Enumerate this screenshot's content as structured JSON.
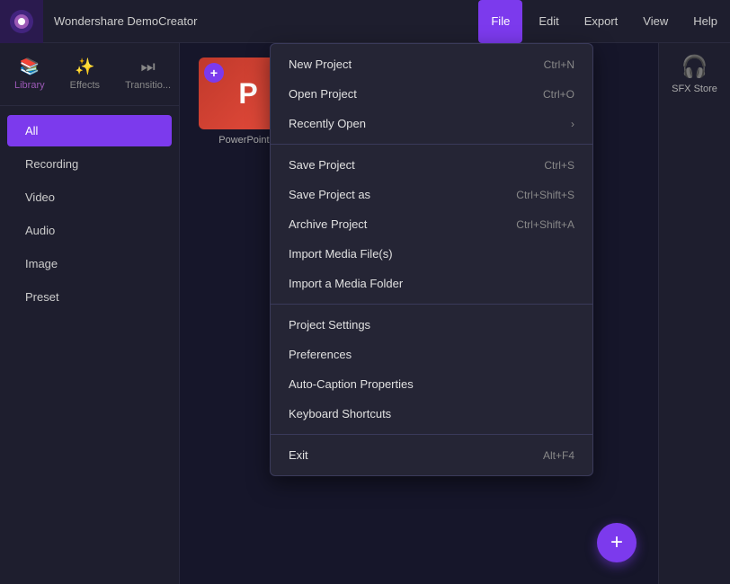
{
  "app": {
    "logo_color": "#7c3aed",
    "title": "Wondershare DemoCreator"
  },
  "menubar": {
    "items": [
      {
        "id": "file",
        "label": "File",
        "active": true
      },
      {
        "id": "edit",
        "label": "Edit",
        "active": false
      },
      {
        "id": "export",
        "label": "Export",
        "active": false
      },
      {
        "id": "view",
        "label": "View",
        "active": false
      },
      {
        "id": "help",
        "label": "Help",
        "active": false
      }
    ]
  },
  "toolbar": {
    "tabs": [
      {
        "id": "library",
        "label": "Library",
        "icon": "📚",
        "active": true
      },
      {
        "id": "effects",
        "label": "Effects",
        "icon": "✨",
        "active": false
      },
      {
        "id": "transitions",
        "label": "Transitio...",
        "icon": "⏭",
        "active": false
      }
    ],
    "sfx": {
      "label": "SFX Store",
      "icon": "🎧"
    }
  },
  "sidebar": {
    "nav_items": [
      {
        "id": "all",
        "label": "All",
        "active": true
      },
      {
        "id": "recording",
        "label": "Recording",
        "active": false
      },
      {
        "id": "video",
        "label": "Video",
        "active": false
      },
      {
        "id": "audio",
        "label": "Audio",
        "active": false
      },
      {
        "id": "image",
        "label": "Image",
        "active": false
      },
      {
        "id": "preset",
        "label": "Preset",
        "active": false
      }
    ]
  },
  "media_items": [
    {
      "id": "powerpoint",
      "label": "PowerPoint...",
      "type": "pp"
    }
  ],
  "dropdown": {
    "sections": [
      {
        "items": [
          {
            "id": "new-project",
            "label": "New Project",
            "shortcut": "Ctrl+N",
            "arrow": false
          },
          {
            "id": "open-project",
            "label": "Open Project",
            "shortcut": "Ctrl+O",
            "arrow": false
          },
          {
            "id": "recently-open",
            "label": "Recently Open",
            "shortcut": "",
            "arrow": true
          }
        ]
      },
      {
        "items": [
          {
            "id": "save-project",
            "label": "Save Project",
            "shortcut": "Ctrl+S",
            "arrow": false
          },
          {
            "id": "save-project-as",
            "label": "Save Project as",
            "shortcut": "Ctrl+Shift+S",
            "arrow": false
          },
          {
            "id": "archive-project",
            "label": "Archive Project",
            "shortcut": "Ctrl+Shift+A",
            "arrow": false
          },
          {
            "id": "import-media-files",
            "label": "Import Media File(s)",
            "shortcut": "",
            "arrow": false
          },
          {
            "id": "import-media-folder",
            "label": "Import a Media Folder",
            "shortcut": "",
            "arrow": false
          }
        ]
      },
      {
        "items": [
          {
            "id": "project-settings",
            "label": "Project Settings",
            "shortcut": "",
            "arrow": false
          },
          {
            "id": "preferences",
            "label": "Preferences",
            "shortcut": "",
            "arrow": false
          },
          {
            "id": "auto-caption",
            "label": "Auto-Caption Properties",
            "shortcut": "",
            "arrow": false
          },
          {
            "id": "keyboard-shortcuts",
            "label": "Keyboard Shortcuts",
            "shortcut": "",
            "arrow": false
          }
        ]
      },
      {
        "items": [
          {
            "id": "exit",
            "label": "Exit",
            "shortcut": "Alt+F4",
            "arrow": false
          }
        ]
      }
    ]
  },
  "fab": {
    "icon": "+",
    "label": "Add"
  }
}
